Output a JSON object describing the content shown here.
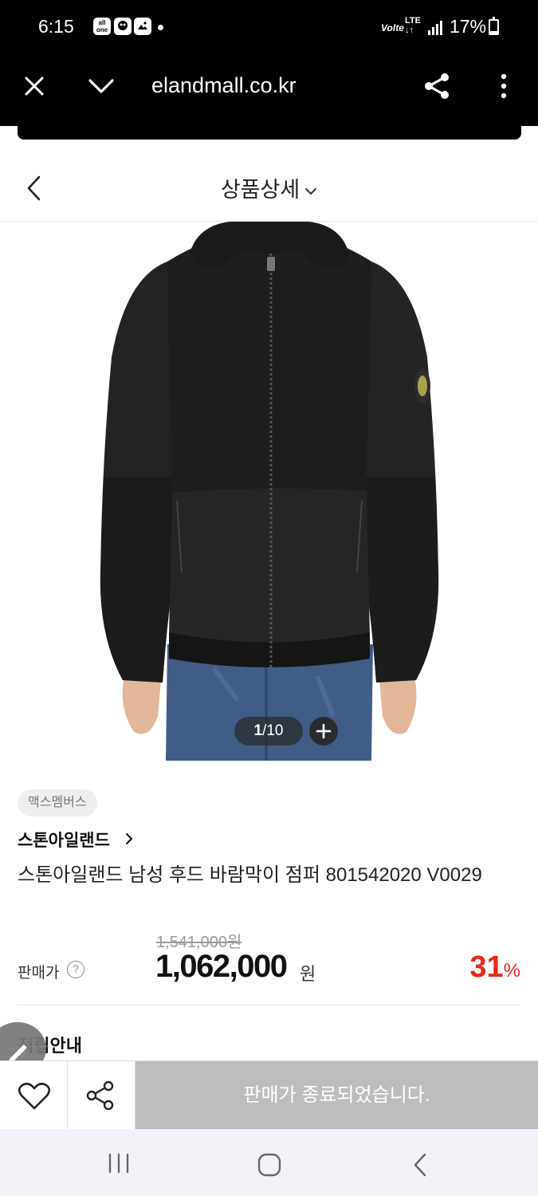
{
  "status_bar": {
    "time": "6:15",
    "badge1": "alll one",
    "network": "Volte",
    "lte": "LTE",
    "battery": "17%",
    "battery_level": 0.17
  },
  "browser": {
    "url": "elandmall.co.kr",
    "close_icon": "close-icon",
    "collapse_icon": "chevron-down-icon",
    "share_icon": "share-icon",
    "menu_icon": "more-vert-icon"
  },
  "header": {
    "title": "상품상세",
    "back_icon": "chevron-left-icon",
    "dropdown_icon": "chevron-down-icon"
  },
  "gallery": {
    "current": "1",
    "total": "10",
    "separator": "/"
  },
  "product": {
    "badge": "맥스멤버스",
    "brand": "스톤아일랜드",
    "name": "스톤아일랜드 남성 후드 바람막이 점퍼 801542020 V0029",
    "original_price": "1,541,000원",
    "price_label": "판매가",
    "help": "?",
    "sale_price": "1,062,000",
    "sale_unit": "원",
    "discount": "31",
    "discount_unit": "%"
  },
  "section": {
    "points_heading": "적립안내"
  },
  "bottom_bar": {
    "soldout_label": "판매가 종료되었습니다."
  },
  "colors": {
    "discount": "#e8291c",
    "soldout_bg": "#bdbdbd",
    "topbar": "#000000"
  }
}
